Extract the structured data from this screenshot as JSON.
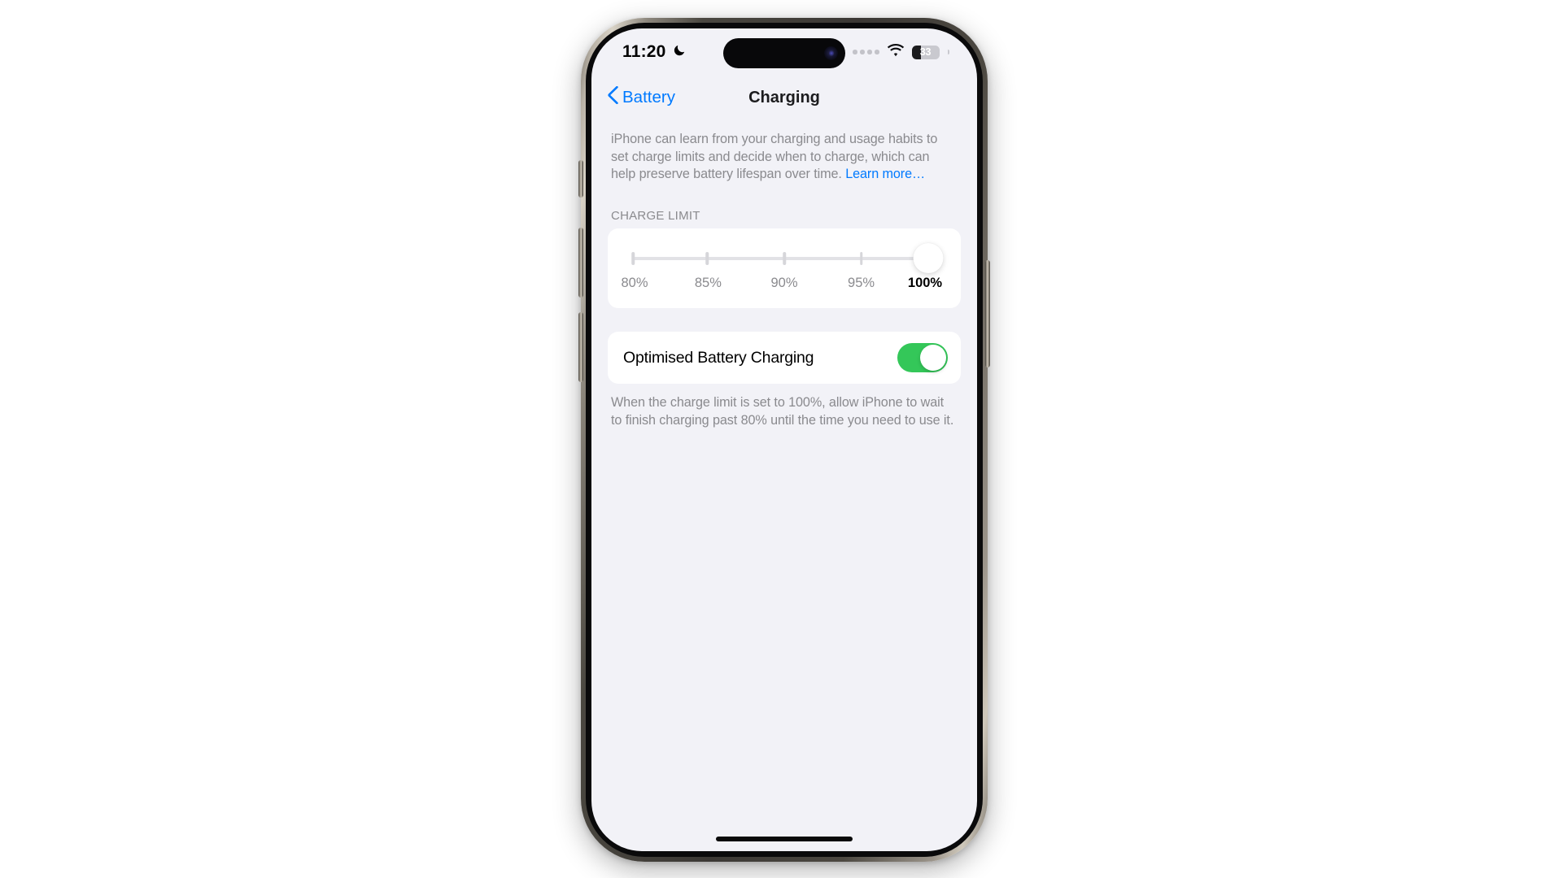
{
  "device": {
    "name": "iphone-15-pro",
    "frame_color": "#3b3834"
  },
  "status_bar": {
    "time": "11:20",
    "dnd_icon": "crescent-moon-icon",
    "cellular_icon": "cellular-dots-icon",
    "cellular_dots": 4,
    "wifi_icon": "wifi-icon",
    "battery_icon": "battery-icon",
    "battery_percent": "33",
    "battery_level": 33
  },
  "nav": {
    "back_label": "Battery",
    "back_icon": "chevron-left-icon",
    "title": "Charging",
    "accent_color": "#007aff"
  },
  "intro": {
    "text": "iPhone can learn from your charging and usage habits to set charge limits and decide when to charge, which can help preserve battery lifespan over time. ",
    "link_text": "Learn more…"
  },
  "charge_limit": {
    "header": "CHARGE LIMIT",
    "options": [
      "80%",
      "85%",
      "90%",
      "95%",
      "100%"
    ],
    "selected": "100%",
    "selected_index": 4,
    "track_color": "#e2e2e6",
    "thumb_color": "#ffffff"
  },
  "optimised_charging": {
    "label": "Optimised Battery Charging",
    "enabled": true,
    "on_color": "#34c759",
    "footer": "When the charge limit is set to 100%, allow iPhone to wait to finish charging past 80% until the time you need to use it."
  },
  "home_indicator": "home-indicator"
}
